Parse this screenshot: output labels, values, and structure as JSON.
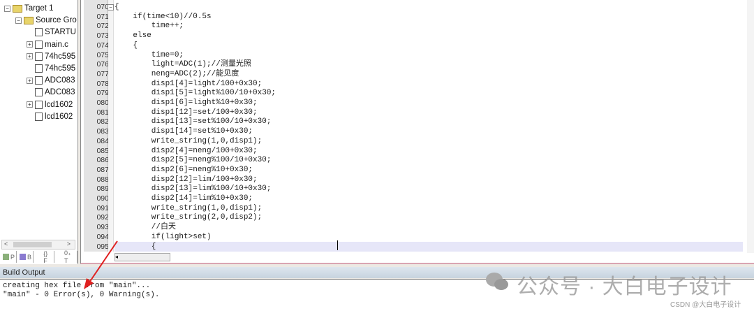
{
  "project_tree": [
    {
      "label": "Target 1",
      "level": 0,
      "type": "target",
      "expander": "−"
    },
    {
      "label": "Source Gro",
      "level": 1,
      "type": "folder",
      "expander": "−"
    },
    {
      "label": "STARTU",
      "level": 2,
      "type": "file",
      "expander": ""
    },
    {
      "label": "main.c",
      "level": 2,
      "type": "file",
      "expander": "+"
    },
    {
      "label": "74hc595",
      "level": 2,
      "type": "file",
      "expander": "+"
    },
    {
      "label": "74hc595",
      "level": 2,
      "type": "header",
      "expander": ""
    },
    {
      "label": "ADC083",
      "level": 2,
      "type": "file",
      "expander": "+"
    },
    {
      "label": "ADC083",
      "level": 2,
      "type": "header",
      "expander": ""
    },
    {
      "label": "lcd1602",
      "level": 2,
      "type": "file",
      "expander": "+"
    },
    {
      "label": "lcd1602",
      "level": 2,
      "type": "header",
      "expander": ""
    }
  ],
  "panel_tabs": [
    {
      "icon": "project-icon",
      "label": "P"
    },
    {
      "icon": "books-icon",
      "label": "B"
    },
    {
      "icon": "functions-icon",
      "label": "{} F"
    },
    {
      "icon": "templates-icon",
      "label": "0₊ T"
    }
  ],
  "editor": {
    "current_line": "095",
    "lines": [
      {
        "n": "070",
        "t": "{"
      },
      {
        "n": "071",
        "t": "    if(time<10)//0.5s"
      },
      {
        "n": "072",
        "t": "        time++;"
      },
      {
        "n": "073",
        "t": "    else"
      },
      {
        "n": "074",
        "t": "    {"
      },
      {
        "n": "075",
        "t": "        time=0;"
      },
      {
        "n": "076",
        "t": "        light=ADC(1);//测量光照"
      },
      {
        "n": "077",
        "t": "        neng=ADC(2);//能见度"
      },
      {
        "n": "078",
        "t": "        disp1[4]=light/100+0x30;"
      },
      {
        "n": "079",
        "t": "        disp1[5]=light%100/10+0x30;"
      },
      {
        "n": "080",
        "t": "        disp1[6]=light%10+0x30;"
      },
      {
        "n": "081",
        "t": "        disp1[12]=set/100+0x30;"
      },
      {
        "n": "082",
        "t": "        disp1[13]=set%100/10+0x30;"
      },
      {
        "n": "083",
        "t": "        disp1[14]=set%10+0x30;"
      },
      {
        "n": "084",
        "t": "        write_string(1,0,disp1);"
      },
      {
        "n": "085",
        "t": "        disp2[4]=neng/100+0x30;"
      },
      {
        "n": "086",
        "t": "        disp2[5]=neng%100/10+0x30;"
      },
      {
        "n": "087",
        "t": "        disp2[6]=neng%10+0x30;"
      },
      {
        "n": "088",
        "t": "        disp2[12]=lim/100+0x30;"
      },
      {
        "n": "089",
        "t": "        disp2[13]=lim%100/10+0x30;"
      },
      {
        "n": "090",
        "t": "        disp2[14]=lim%10+0x30;"
      },
      {
        "n": "091",
        "t": "        write_string(1,0,disp1);"
      },
      {
        "n": "092",
        "t": "        write_string(2,0,disp2);"
      },
      {
        "n": "093",
        "t": "        //白天"
      },
      {
        "n": "094",
        "t": "        if(light>set)"
      },
      {
        "n": "095",
        "t": "        {"
      }
    ]
  },
  "build_output": {
    "title": "Build Output",
    "lines": [
      "creating hex file from \"main\"...",
      "\"main\" - 0 Error(s), 0 Warning(s)."
    ]
  },
  "watermark": {
    "text": "公众号 · 大白电子设计",
    "csdn": "CSDN @大白电子设计"
  },
  "colors": {
    "number": "#a0407a",
    "comment": "#1f9a8a",
    "arrow": "#e02020"
  }
}
